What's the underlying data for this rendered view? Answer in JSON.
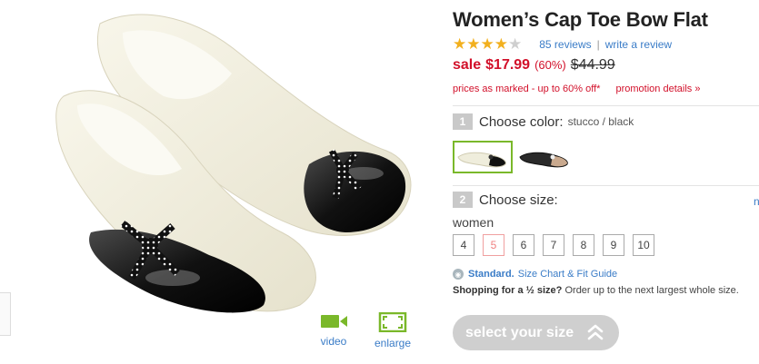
{
  "product": {
    "title": "Women’s Cap Toe Bow Flat",
    "rating": 4,
    "max_rating": 5,
    "reviews_label": "85 reviews",
    "write_review_label": "write a review",
    "review_separator": "|"
  },
  "pricing": {
    "sale_label": "sale",
    "sale_price": "$17.99",
    "percent_off": "(60%)",
    "original_price": "$44.99",
    "promo_text": "prices as marked - up to 60% off*",
    "promo_details_label": "promotion details »",
    "sale_color": "#d2102a"
  },
  "color_step": {
    "number": "1",
    "label": "Choose color:",
    "selected_value": "stucco / black",
    "swatches": [
      {
        "name": "stucco / black",
        "selected": true
      },
      {
        "name": "black",
        "selected": false
      }
    ]
  },
  "size_step": {
    "number": "2",
    "label": "Choose size:",
    "group_label": "women",
    "sizes": [
      {
        "label": "4",
        "available": true
      },
      {
        "label": "5",
        "available": false
      },
      {
        "label": "6",
        "available": true
      },
      {
        "label": "7",
        "available": true
      },
      {
        "label": "8",
        "available": true
      },
      {
        "label": "9",
        "available": true
      },
      {
        "label": "10",
        "available": true
      }
    ],
    "edge_text": "n"
  },
  "fit": {
    "standard_label": "Standard.",
    "guide_label": "Size Chart & Fit Guide",
    "half_size_bold": "Shopping for a ½ size?",
    "half_size_text": "Order up to the next largest whole size."
  },
  "media": {
    "video_label": "video",
    "enlarge_label": "enlarge",
    "accent": "#7ab82a"
  },
  "cta": {
    "label": "select your size",
    "icon": "double-chevron-up-icon"
  }
}
